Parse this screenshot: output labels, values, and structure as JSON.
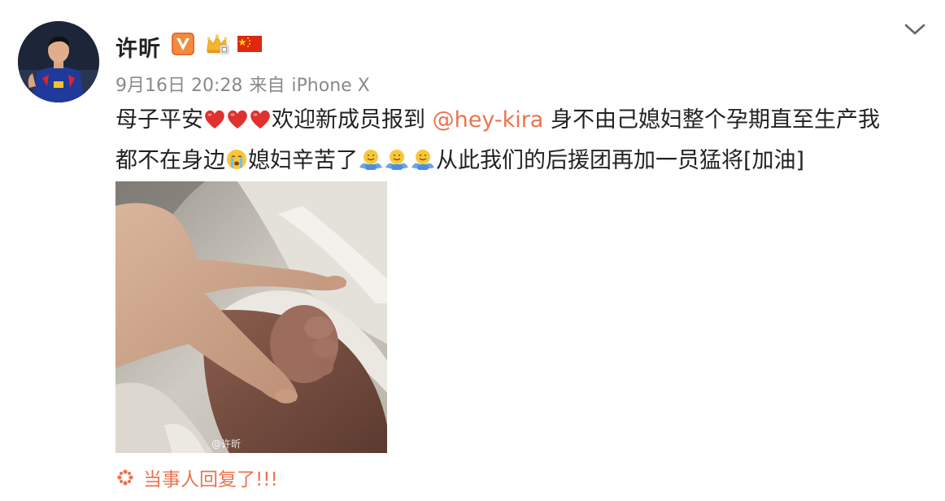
{
  "user": {
    "name": "许昕",
    "avatar_icon": "avatar-photo"
  },
  "badges": [
    "verified-v-icon",
    "vip-crown-icon",
    "china-flag-icon"
  ],
  "meta": {
    "time": "9月16日 20:28",
    "source_prefix": "来自",
    "source": "iPhone X"
  },
  "post": {
    "line1_a": "母子平安",
    "line1_b": "欢迎新成员报到 ",
    "mention": "@hey-kira",
    "line1_c": " 身不由己媳妇整个孕期直至生产我",
    "line2_a": "都不在身边",
    "line2_b": "媳妇辛苦了",
    "line2_c": "从此我们的后援团再加一员猛将[加油]"
  },
  "image": {
    "watermark": "@许昕"
  },
  "footer": {
    "reply_text": "当事人回复了!!!"
  },
  "colors": {
    "accent": "#eb7350",
    "meta_gray": "#8a8a8a",
    "text": "#222222"
  }
}
